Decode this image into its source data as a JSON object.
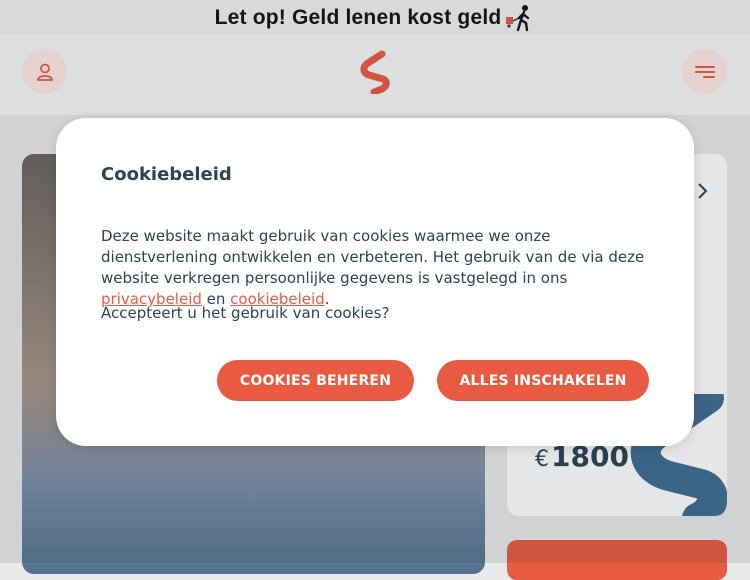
{
  "banner": {
    "text": "Let op! Geld lenen kost geld"
  },
  "colors": {
    "accent": "#e85b42",
    "text": "#2d4356",
    "icon_bg": "#ffe9e4"
  },
  "header": {
    "icons": [
      "account-icon",
      "brand-logo",
      "menu-icon"
    ]
  },
  "card": {
    "currency": "€",
    "amount": "1800"
  },
  "modal": {
    "title": "Cookiebeleid",
    "body_text": "Deze website maakt gebruik van cookies waarmee we onze dienstverlening ontwikkelen en verbeteren. Het gebruik van de via deze website verkregen persoonlijke gegevens is vastgelegd in ons ",
    "privacy_link": "privacybeleid",
    "conjunction": " en ",
    "cookie_link": "cookiebeleid",
    "end": ".",
    "question": "Accepteert u het gebruik van cookies?",
    "manage_button": "COOKIES BEHEREN",
    "accept_button": "ALLES INSCHAKELEN"
  }
}
